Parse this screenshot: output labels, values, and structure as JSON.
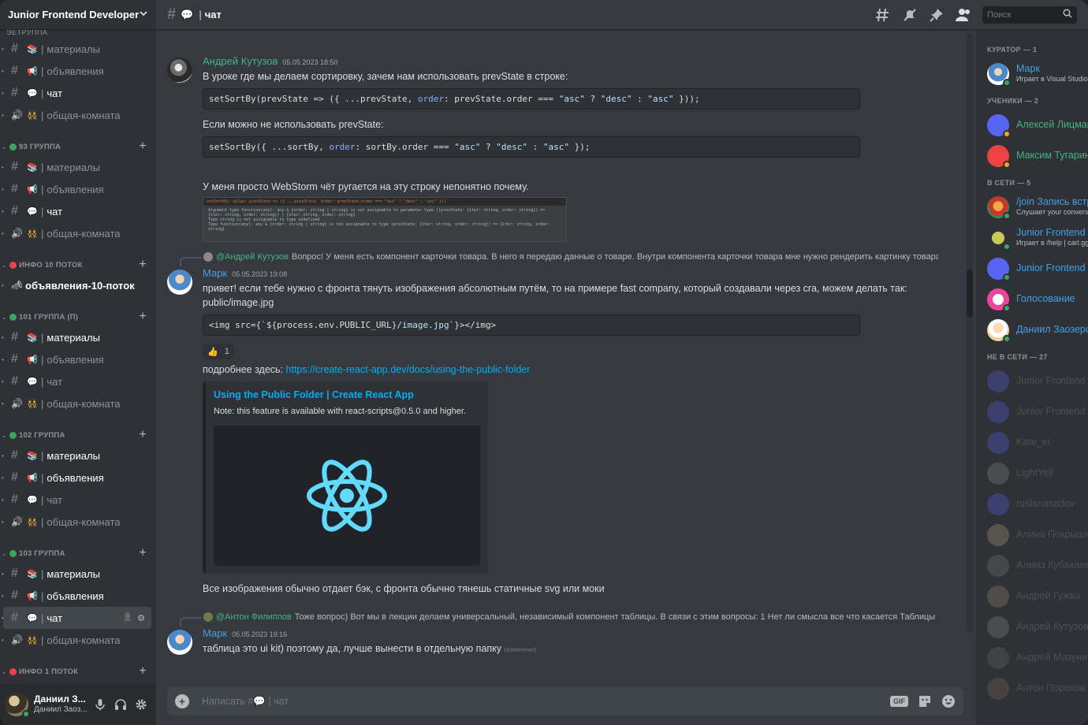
{
  "server": {
    "name": "Junior Frontend Developer"
  },
  "sidebar": {
    "scroll_remnant": "ЭЕТРУППА",
    "top_channels": [
      {
        "icon": "📚",
        "name": "материалы",
        "type": "text"
      },
      {
        "icon": "📢",
        "name": "объявления",
        "type": "text"
      },
      {
        "icon": "💬",
        "name": "чат",
        "type": "text",
        "unread": true
      },
      {
        "icon": "👯",
        "name": "общая-комната",
        "type": "voice"
      }
    ],
    "categories": [
      {
        "name": "93 группа",
        "dot": "#3ba55d",
        "channels": [
          {
            "icon": "📚",
            "name": "материалы",
            "type": "text"
          },
          {
            "icon": "📢",
            "name": "объявления",
            "type": "text"
          },
          {
            "icon": "💬",
            "name": "чат",
            "type": "text",
            "unread": true
          },
          {
            "icon": "👯",
            "name": "общая-комната",
            "type": "voice"
          }
        ]
      },
      {
        "name": "инфо 10 поток",
        "dot": "#ed4245",
        "channels": [
          {
            "icon": "📣",
            "name": "объявления-10-поток",
            "type": "announce"
          }
        ]
      },
      {
        "name": "101 группа (П)",
        "dot": "#3ba55d",
        "channels": [
          {
            "icon": "📚",
            "name": "материалы",
            "type": "text",
            "unread": true
          },
          {
            "icon": "📢",
            "name": "объявления",
            "type": "text"
          },
          {
            "icon": "💬",
            "name": "чат",
            "type": "text"
          },
          {
            "icon": "👯",
            "name": "общая-комната",
            "type": "voice"
          }
        ]
      },
      {
        "name": "102 группа",
        "dot": "#3ba55d",
        "channels": [
          {
            "icon": "📚",
            "name": "материалы",
            "type": "text",
            "unread": true
          },
          {
            "icon": "📢",
            "name": "объявления",
            "type": "text",
            "unread": true
          },
          {
            "icon": "💬",
            "name": "чат",
            "type": "text"
          },
          {
            "icon": "👯",
            "name": "общая-комната",
            "type": "voice"
          }
        ]
      },
      {
        "name": "103 группа",
        "dot": "#3ba55d",
        "channels": [
          {
            "icon": "📚",
            "name": "материалы",
            "type": "text",
            "unread": true
          },
          {
            "icon": "📢",
            "name": "объявления",
            "type": "text",
            "unread": true
          },
          {
            "icon": "💬",
            "name": "чат",
            "type": "text",
            "active": true
          },
          {
            "icon": "👯",
            "name": "общая-комната",
            "type": "voice"
          }
        ]
      },
      {
        "name": "инфо 1 поток",
        "dot": "#ed4245",
        "channels": [
          {
            "icon": "📣",
            "name": "объявления-1-поток",
            "type": "announce"
          }
        ]
      }
    ]
  },
  "user_panel": {
    "name": "Даниил З...",
    "tag": "Даниил Заоз..."
  },
  "topbar": {
    "channel_icon": "💬",
    "channel_name": "чат",
    "search_placeholder": "Поиск"
  },
  "messages": {
    "m1": {
      "author": "Андрей Кутузов",
      "timestamp": "05.05.2023 18:50",
      "text1": "В уроке где мы делаем сортировку, зачем нам использовать prevState в строке:",
      "text2": "Если можно не использовать prevState:",
      "text3": "У меня просто WebStorm чёт ругается на эту строку непонятно почему.",
      "screenshot_lines": [
        "setSortBy( value: prevState => ({ ...prevState, order: prevState.order === \"asc\" ? \"desc\" : \"asc\" }))",
        "Argument type function(any): any & {order: string | string} is not assignable to parameter type ((prevState: {iter: string, order: string}) => {iter: string, order: string}) | {iter: string, order: string}",
        "Type string is not assignable to type undefined",
        "Type function(any): any & {order: string | string} is not assignable to type (prevState: {iter: string, order: string}) => {iter: string, order: string}"
      ]
    },
    "m2": {
      "reply_mention": "@Андрей Кутузов",
      "reply_text": "Вопрос! У меня есть компонент карточки товара. В него я передаю данные о товаре. Внутри компонента карточки товара мне нужно рендерить картинку товара",
      "author": "Марк",
      "timestamp": "05.05.2023 19:08",
      "text": "привет! если тебе нужно с фронта тянуть изображения абсолютным путём, то на примере fast company, который создавали через cra, можем делать так: public/image.jpg",
      "reaction_emoji": "👍",
      "reaction_count": "1",
      "more_label": "подробнее здесь:",
      "link": "https://create-react-app.dev/docs/using-the-public-folder",
      "embed_title": "Using the Public Folder | Create React App",
      "embed_desc": "Note: this feature is available with react-scripts@0.5.0 and higher.",
      "text_after": "Все изображения обычно отдает бэк, с фронта обычно тянешь статичные svg или моки"
    },
    "m3": {
      "reply_mention": "@Антон Филиппов",
      "reply_text": "Тоже вопрос) Вот мы в лекции делаем универсальный, независимый компонент таблицы. В связи с этим вопросы: 1 Нет ли смысла все что касается Таблицы",
      "author": "Марк",
      "timestamp": "05.05.2023 19:16",
      "text": "таблица это ui kit) поэтому да, лучше вынести в отдельную папку",
      "edited": "(изменено)"
    }
  },
  "composer": {
    "placeholder": "Написать #💬 | чат"
  },
  "members": {
    "curator_title": "Куратор — 1",
    "students_title": "Ученики — 2",
    "online_title": "В сети — 5",
    "offline_title": "Не в сети — 27",
    "curator": [
      {
        "name": "Марк",
        "sub": "Играет в Visual Studio Code",
        "color": "blue"
      }
    ],
    "students": [
      {
        "name": "Алексей Лицман",
        "color": "green"
      },
      {
        "name": "Максим Тугаринов",
        "color": "green"
      }
    ],
    "online": [
      {
        "name": "/join Запись встречи",
        "sub": "Слушает your conversation",
        "color": "blue"
      },
      {
        "name": "Junior Frontend",
        "sub": "Играет в /help | carl.gg",
        "color": "blue"
      },
      {
        "name": "Junior Frontend",
        "sub": "",
        "color": "blue"
      },
      {
        "name": "Голосование",
        "sub": "",
        "color": "blue"
      },
      {
        "name": "Даниил Заозерский",
        "sub": "",
        "color": "blue"
      }
    ],
    "offline": [
      {
        "name": "Junior Frontend"
      },
      {
        "name": "Junior Frontend"
      },
      {
        "name": "Kate_ei"
      },
      {
        "name": "LightYell"
      },
      {
        "name": "ruslanasadov"
      },
      {
        "name": "Алина Покрышкина"
      },
      {
        "name": "Алмаз Кубакаев"
      },
      {
        "name": "Андрей Гужва"
      },
      {
        "name": "Андрей Кутузов"
      },
      {
        "name": "Андрей Мазунин"
      },
      {
        "name": "Антон Порохов"
      }
    ]
  }
}
